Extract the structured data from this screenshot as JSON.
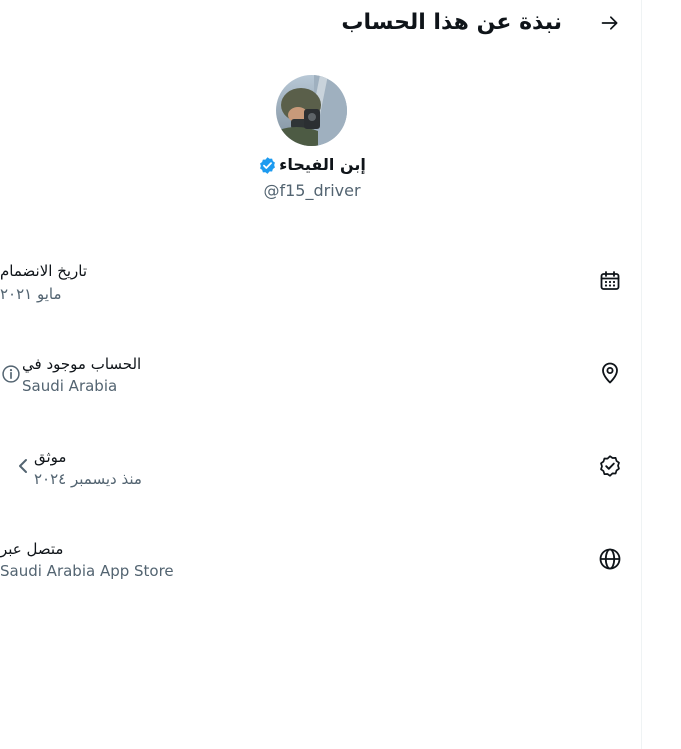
{
  "header": {
    "title": "نبذة عن هذا الحساب"
  },
  "profile": {
    "display_name": "إبن الفيحاء",
    "handle": "@f15_driver",
    "verified_color": "#1d9bf0"
  },
  "details": {
    "joined": {
      "label": "تاريخ الانضمام",
      "value": "مايو ٢٠٢١",
      "icon": "calendar-icon"
    },
    "location": {
      "label": "الحساب موجود في",
      "value": "Saudi Arabia",
      "icon": "location-pin-icon"
    },
    "verified": {
      "label": "موثق",
      "value": "منذ ديسمبر ٢٠٢٤",
      "icon": "verified-check-icon"
    },
    "connected": {
      "label": "متصل عبر",
      "value": "Saudi Arabia App Store",
      "icon": "globe-icon"
    }
  }
}
